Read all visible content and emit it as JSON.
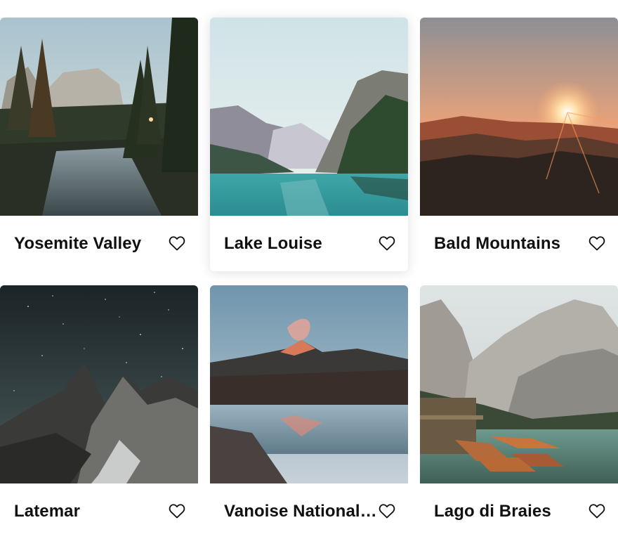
{
  "cards": [
    {
      "title": "Yosemite Valley",
      "image": "photo-yosemite-valley",
      "favorite_icon": "heart-outline-icon"
    },
    {
      "title": "Lake Louise",
      "image": "photo-lake-louise",
      "favorite_icon": "heart-outline-icon"
    },
    {
      "title": "Bald Mountains",
      "image": "photo-bald-mountains",
      "favorite_icon": "heart-outline-icon"
    },
    {
      "title": "Latemar",
      "image": "photo-latemar",
      "favorite_icon": "heart-outline-icon"
    },
    {
      "title": "Vanoise National Park",
      "image": "photo-vanoise",
      "favorite_icon": "heart-outline-icon"
    },
    {
      "title": "Lago di Braies",
      "image": "photo-lago-di-braies",
      "favorite_icon": "heart-outline-icon"
    }
  ]
}
